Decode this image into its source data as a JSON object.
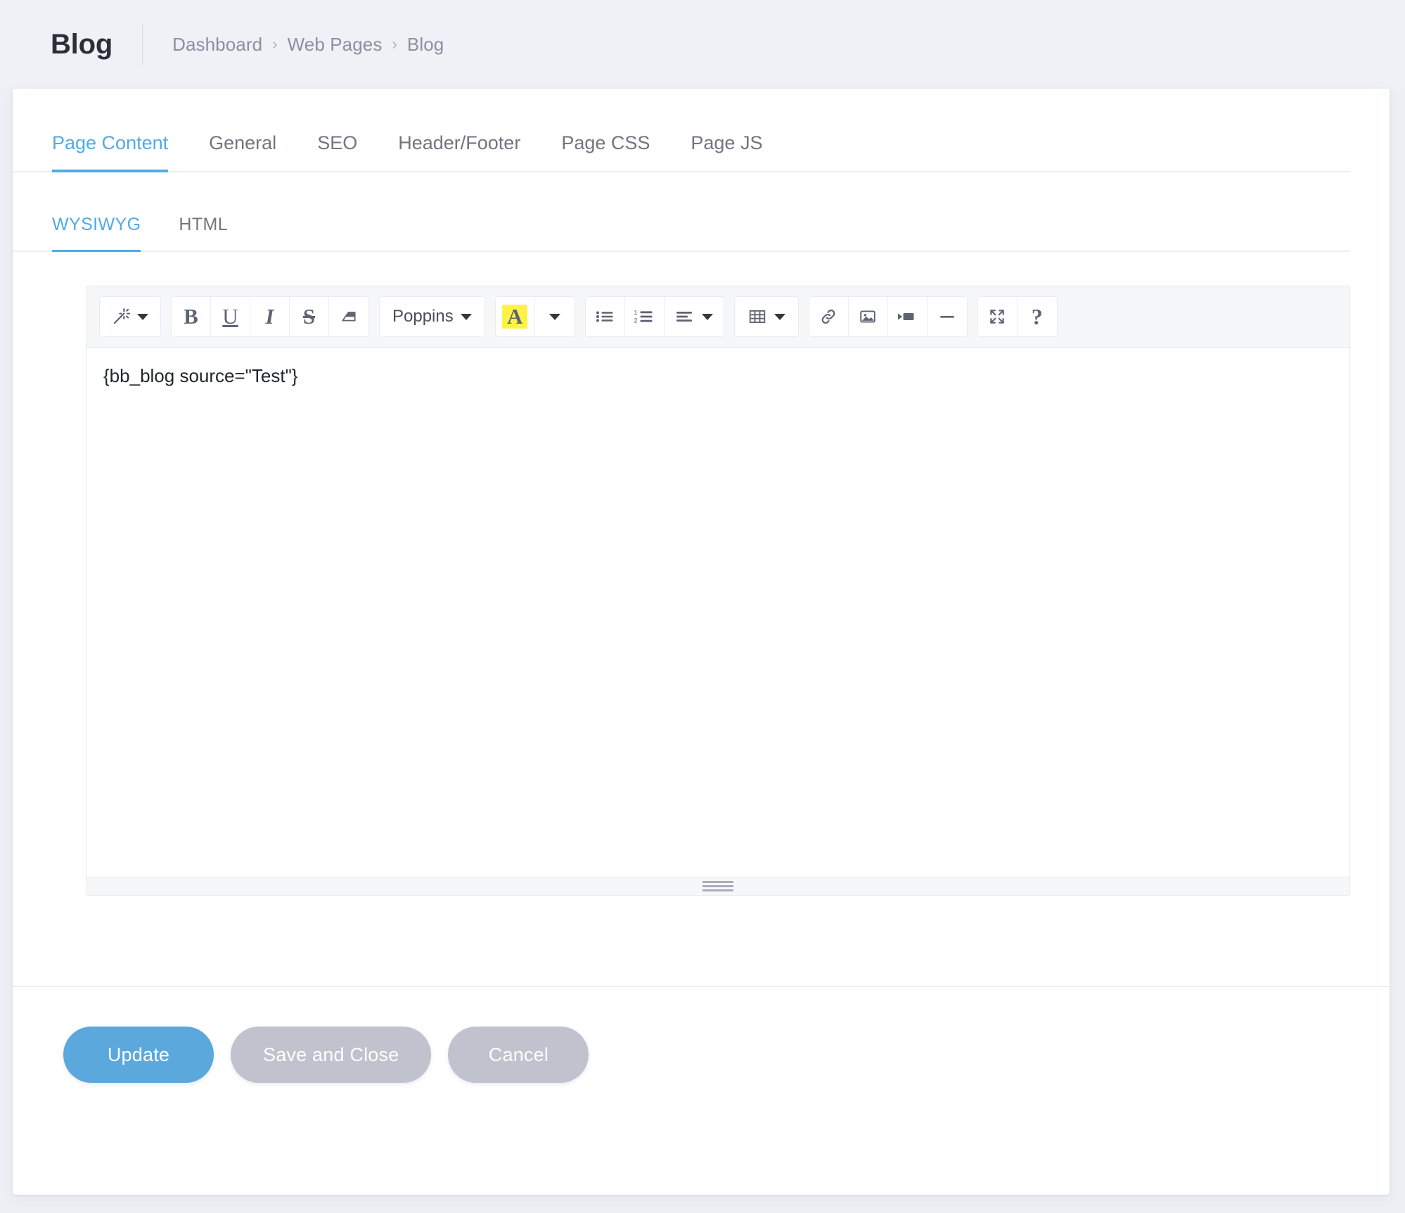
{
  "header": {
    "title": "Blog",
    "breadcrumb": [
      {
        "label": "Dashboard"
      },
      {
        "label": "Web Pages"
      },
      {
        "label": "Blog"
      }
    ],
    "breadcrumb_separator": "›"
  },
  "tabs": {
    "items": [
      {
        "label": "Page Content",
        "active": true
      },
      {
        "label": "General",
        "active": false
      },
      {
        "label": "SEO",
        "active": false
      },
      {
        "label": "Header/Footer",
        "active": false
      },
      {
        "label": "Page CSS",
        "active": false
      },
      {
        "label": "Page JS",
        "active": false
      }
    ]
  },
  "subtabs": {
    "items": [
      {
        "label": "WYSIWYG",
        "active": true
      },
      {
        "label": "HTML",
        "active": false
      }
    ]
  },
  "editor": {
    "font_label": "Poppins",
    "highlight_letter": "A",
    "content": "{bb_blog source=\"Test\"}",
    "help_label": "?",
    "toolbar_icons": [
      "magic-wand-icon",
      "bold-icon",
      "underline-icon",
      "italic-icon",
      "strikethrough-icon",
      "eraser-icon",
      "font-family-select",
      "text-highlight-icon",
      "bulleted-list-icon",
      "numbered-list-icon",
      "align-icon",
      "table-icon",
      "link-icon",
      "image-icon",
      "video-icon",
      "horizontal-rule-icon",
      "fullscreen-icon",
      "help-icon"
    ]
  },
  "footer": {
    "update_label": "Update",
    "save_close_label": "Save and Close",
    "cancel_label": "Cancel"
  },
  "colors": {
    "accent": "#54a9e4",
    "primary_button": "#5ba8dd",
    "muted_button": "#c0c2ce",
    "highlight_yellow": "#fdf348",
    "page_background": "#eff1f6"
  }
}
